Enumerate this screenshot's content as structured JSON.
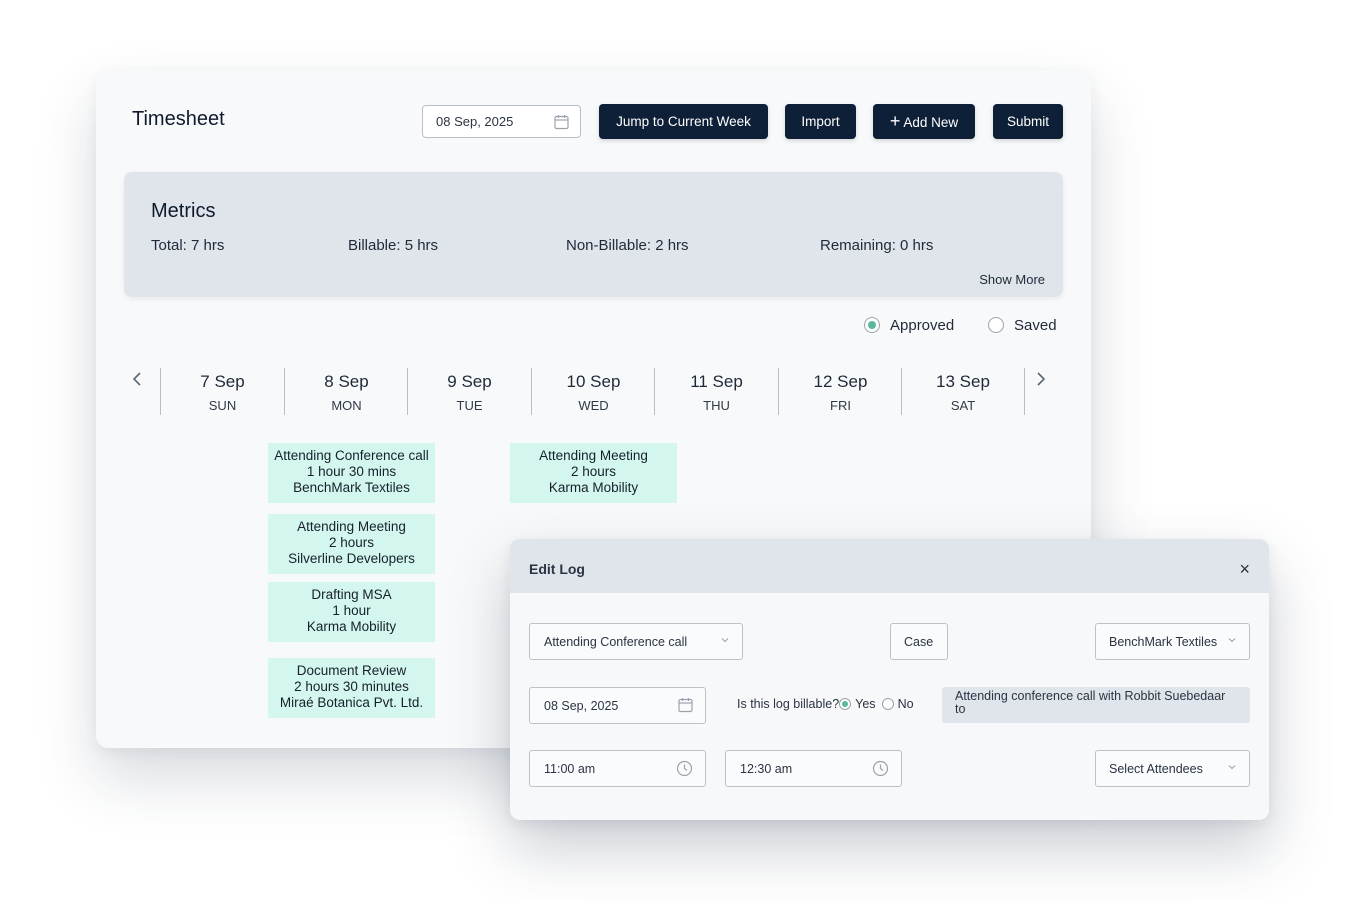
{
  "header": {
    "title": "Timesheet",
    "date_value": "08 Sep, 2025",
    "buttons": {
      "jump": "Jump to Current Week",
      "import": "Import",
      "add_new_icon": "+",
      "add_new": "Add New",
      "submit": "Submit"
    }
  },
  "metrics": {
    "title": "Metrics",
    "total": "Total: 7 hrs",
    "billable": "Billable: 5 hrs",
    "non_billable": "Non-Billable: 2 hrs",
    "remaining": "Remaining: 0 hrs",
    "show_more": "Show More"
  },
  "legend": {
    "approved": "Approved",
    "saved": "Saved",
    "approved_color": "#5bb89a"
  },
  "week": {
    "prev_icon": "chevron-left-icon",
    "next_icon": "chevron-right-icon",
    "days": [
      {
        "date": "7 Sep",
        "weekday": "SUN"
      },
      {
        "date": "8 Sep",
        "weekday": "MON"
      },
      {
        "date": "9 Sep",
        "weekday": "TUE"
      },
      {
        "date": "10 Sep",
        "weekday": "WED"
      },
      {
        "date": "11 Sep",
        "weekday": "THU"
      },
      {
        "date": "12 Sep",
        "weekday": "FRI"
      },
      {
        "date": "13 Sep",
        "weekday": "SAT"
      }
    ]
  },
  "entries": [
    {
      "day": "MON",
      "title": "Attending Conference call",
      "duration": "1 hour 30 mins",
      "client": "BenchMark Textiles"
    },
    {
      "day": "MON",
      "title": "Attending Meeting",
      "duration": "2 hours",
      "client": "Silverline Developers"
    },
    {
      "day": "MON",
      "title": "Drafting MSA",
      "duration": "1 hour",
      "client": "Karma Mobility"
    },
    {
      "day": "MON",
      "title": "Document Review",
      "duration": "2 hours 30 minutes",
      "client": "Miraé Botanica Pvt. Ltd."
    },
    {
      "day": "WED",
      "title": "Attending Meeting",
      "duration": "2 hours",
      "client": "Karma Mobility"
    }
  ],
  "entry_color": "#d3f7ee",
  "edit_log": {
    "title": "Edit Log",
    "close_icon": "×",
    "activity": "Attending Conference call",
    "case": "Case",
    "client": "BenchMark Textiles",
    "date": "08 Sep, 2025",
    "billable_question": "Is this log billable?",
    "yes": "Yes",
    "no": "No",
    "billable_selected": "Yes",
    "description": "Attending conference call with Robbit Suebedaar to",
    "start_time": "11:00 am",
    "end_time": "12:30 am",
    "attendees_placeholder": "Select Attendees"
  },
  "brand_color": "#0e2037"
}
